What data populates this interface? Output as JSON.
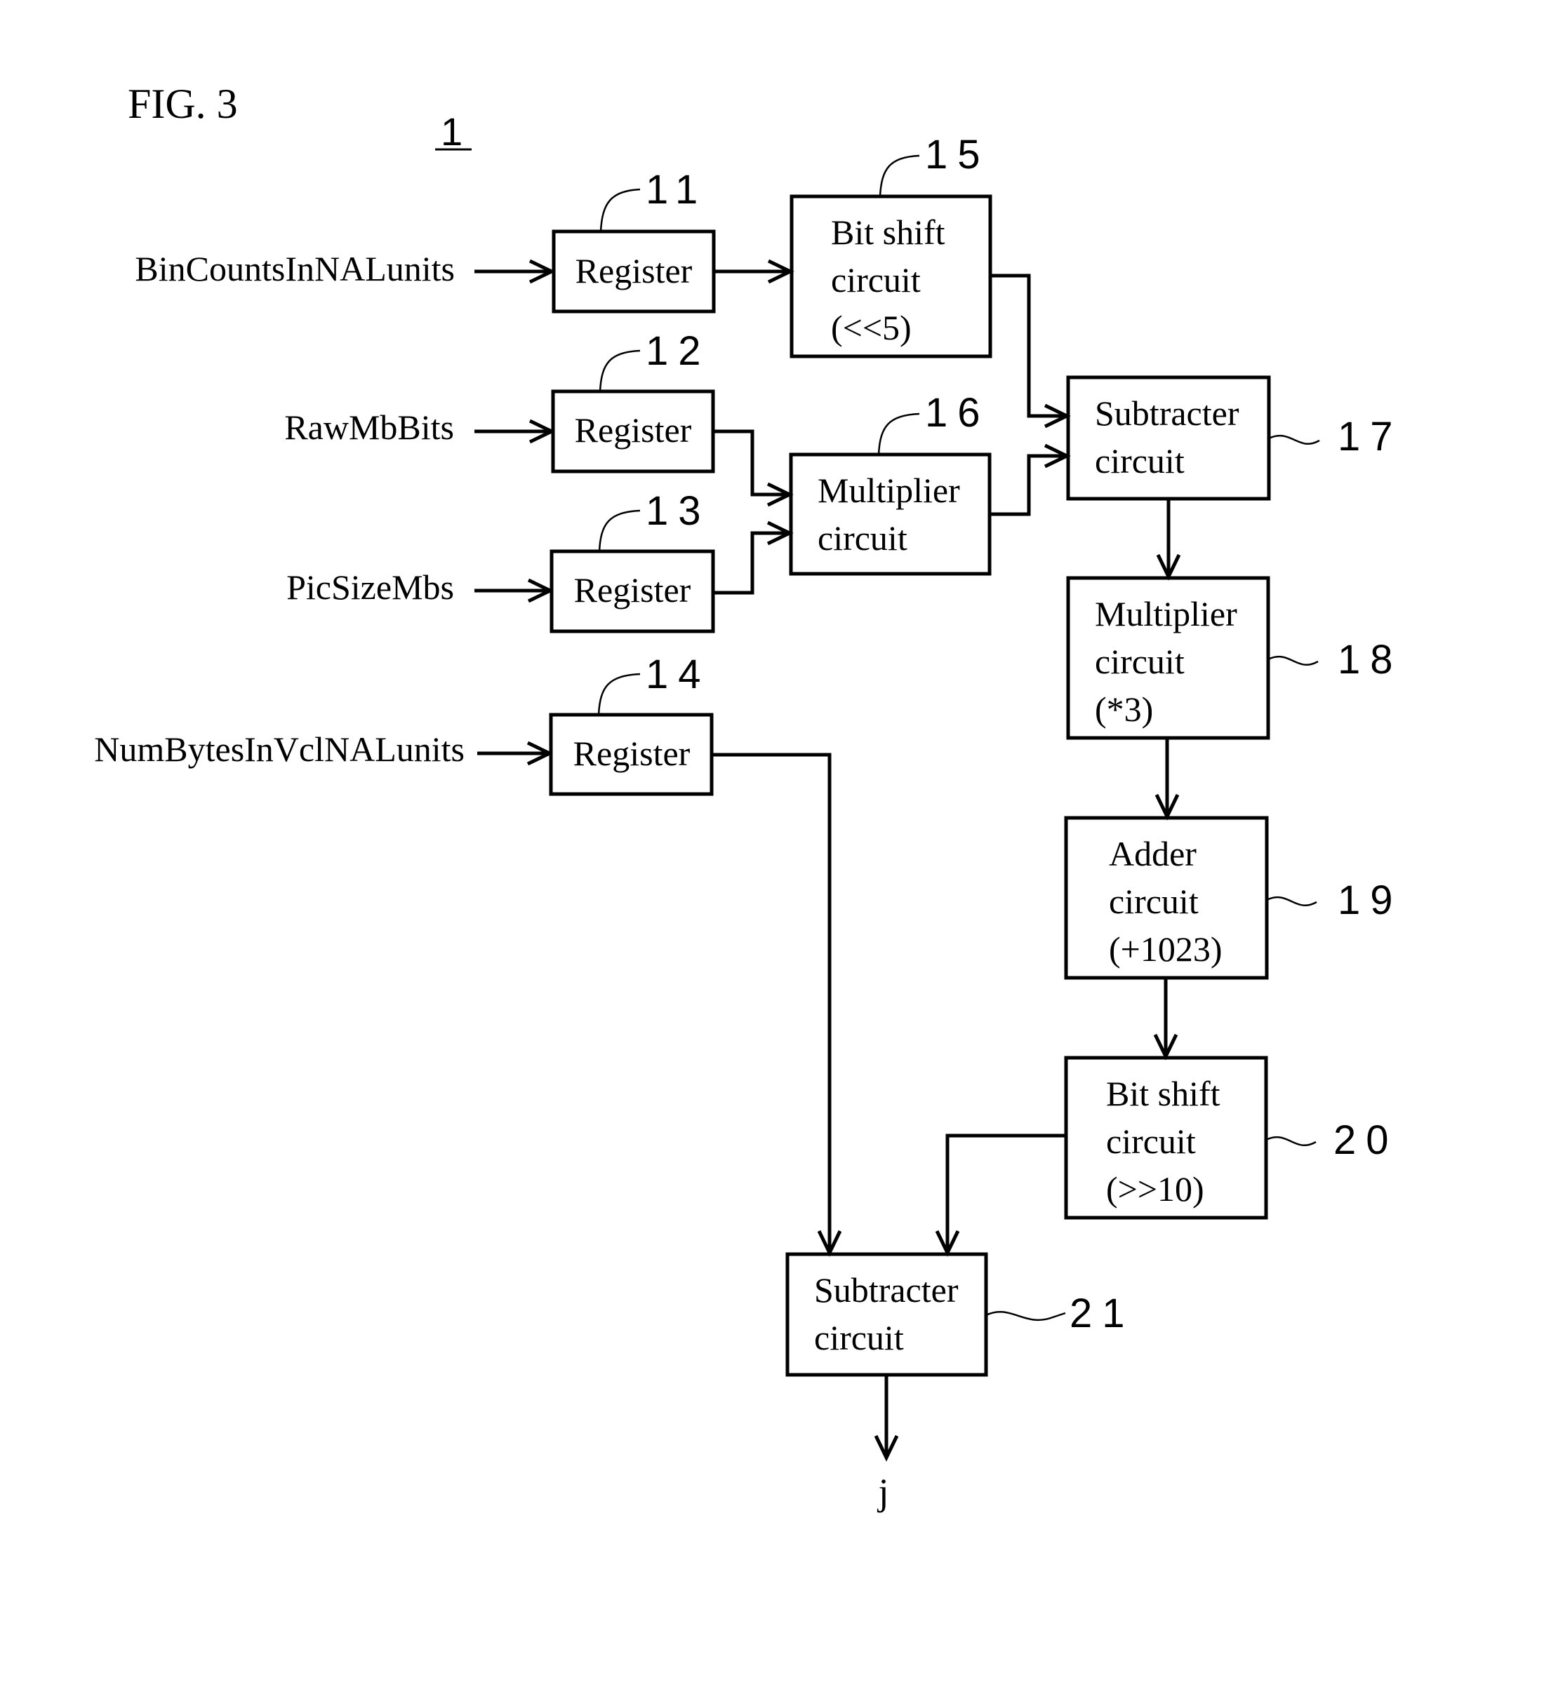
{
  "figure": {
    "title": "FIG. 3",
    "device_ref": "1"
  },
  "inputs": [
    {
      "label": "BinCountsInNALunits"
    },
    {
      "label": "RawMbBits"
    },
    {
      "label": "PicSizeMbs"
    },
    {
      "label": "NumBytesInVclNALunits"
    }
  ],
  "blocks": {
    "r11": {
      "ref": "11",
      "lines": [
        "Register"
      ]
    },
    "r12": {
      "ref": "12",
      "lines": [
        "Register"
      ]
    },
    "r13": {
      "ref": "13",
      "lines": [
        "Register"
      ]
    },
    "r14": {
      "ref": "14",
      "lines": [
        "Register"
      ]
    },
    "b15": {
      "ref": "15",
      "lines": [
        "Bit shift",
        "circuit",
        "(<<5)"
      ]
    },
    "b16": {
      "ref": "16",
      "lines": [
        "Multiplier",
        "circuit"
      ]
    },
    "b17": {
      "ref": "17",
      "lines": [
        "Subtracter",
        "circuit"
      ]
    },
    "b18": {
      "ref": "18",
      "lines": [
        "Multiplier",
        "circuit",
        "(*3)"
      ]
    },
    "b19": {
      "ref": "19",
      "lines": [
        "Adder",
        "circuit",
        "(+1023)"
      ]
    },
    "b20": {
      "ref": "20",
      "lines": [
        "Bit shift",
        "circuit",
        "(>>10)"
      ]
    },
    "b21": {
      "ref": "21",
      "lines": [
        "Subtracter",
        "circuit"
      ]
    }
  },
  "output": {
    "label": "j"
  }
}
